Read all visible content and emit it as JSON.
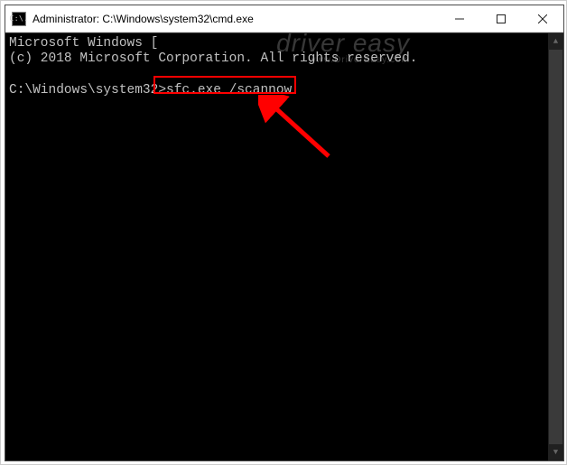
{
  "title": "Administrator: C:\\Windows\\system32\\cmd.exe",
  "icon_text": "C:\\.",
  "terminal": {
    "line1": "Microsoft Windows [",
    "line2": "(c) 2018 Microsoft Corporation. All rights reserved.",
    "prompt": "C:\\Windows\\system32>",
    "command": "sfc.exe /scannow"
  },
  "watermark": {
    "big": "driver easy",
    "small": "www.DriverEasy.com"
  },
  "scroll": {
    "up": "▲",
    "down": "▼"
  },
  "highlight_color": "#ff0000"
}
